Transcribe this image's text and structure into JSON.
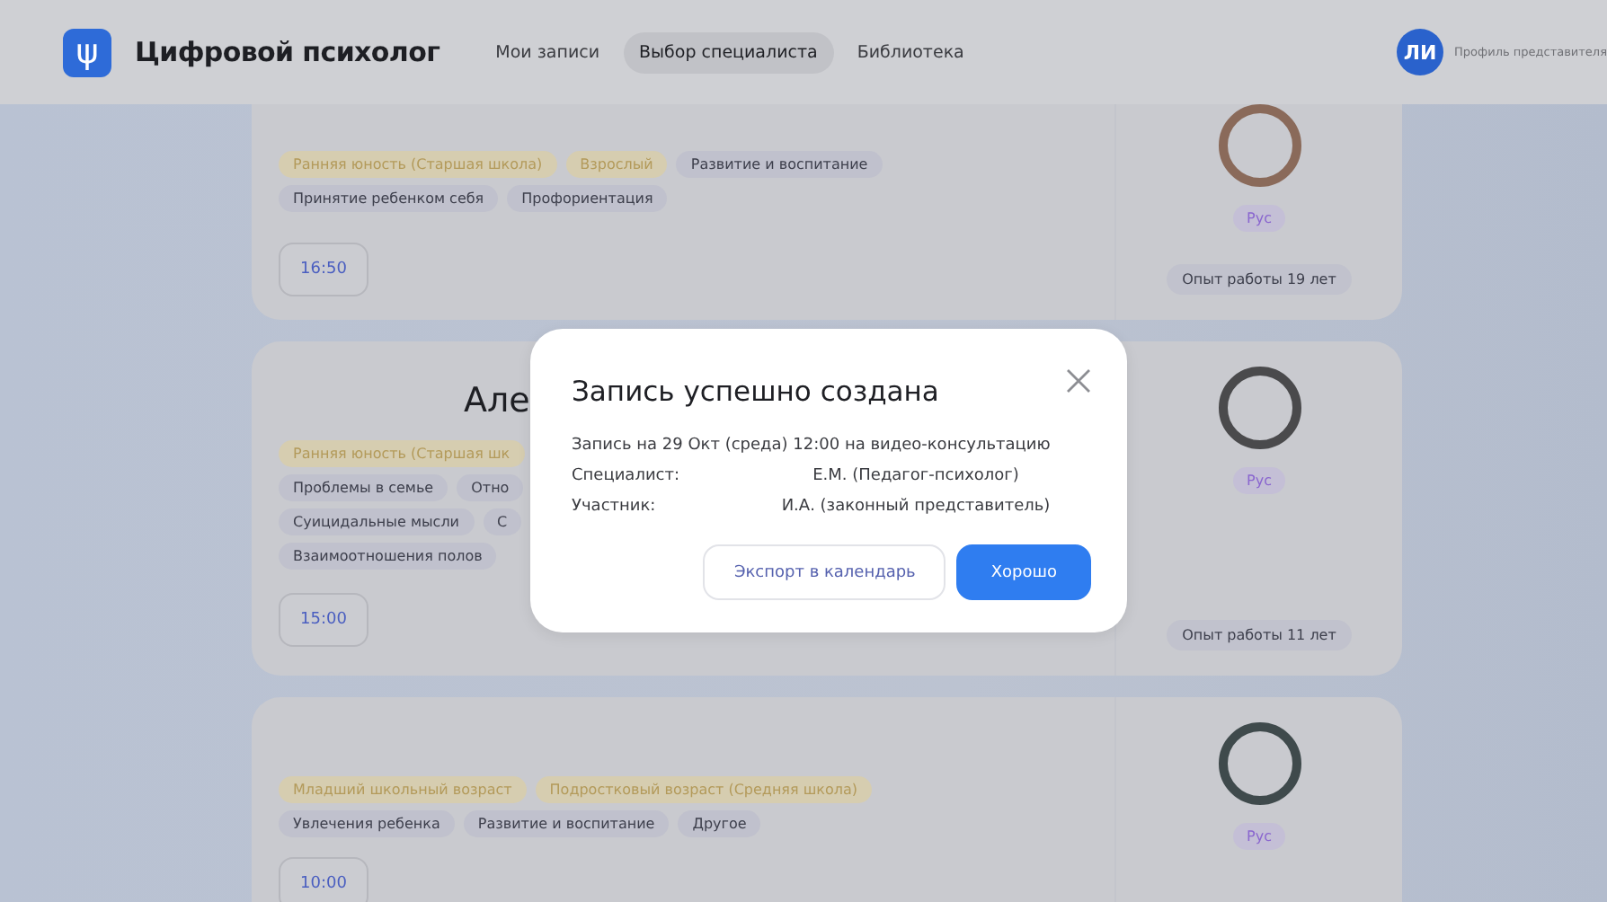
{
  "header": {
    "logo_glyph": "ψ",
    "app_title": "Цифровой психолог",
    "nav": [
      {
        "label": "Мои записи",
        "selected": false
      },
      {
        "label": "Выбор специалиста",
        "selected": true
      },
      {
        "label": "Библиотека",
        "selected": false
      }
    ],
    "profile": {
      "initials": "ЛИ",
      "label": "Профиль представителя"
    }
  },
  "specialists": [
    {
      "tags": [
        {
          "text": "Ранняя юность (Старшая школа)",
          "kind": "age"
        },
        {
          "text": "Взрослый",
          "kind": "age"
        },
        {
          "text": "Развитие и воспитание",
          "kind": "topic"
        },
        {
          "text": "Принятие ребенком себя",
          "kind": "topic"
        },
        {
          "text": "Профориентация",
          "kind": "topic"
        }
      ],
      "time": "16:50",
      "language": "Рус",
      "experience": "Опыт работы 19 лет"
    },
    {
      "name": "Але",
      "tags": [
        {
          "text": "Ранняя юность (Старшая шк",
          "kind": "age"
        },
        {
          "text": "Проблемы в семье",
          "kind": "topic"
        },
        {
          "text": "Отно",
          "kind": "topic"
        },
        {
          "text": "Суицидальные мысли",
          "kind": "topic"
        },
        {
          "text": "С",
          "kind": "topic"
        },
        {
          "text": "Взаимоотношения полов",
          "kind": "topic"
        }
      ],
      "time": "15:00",
      "language": "Рус",
      "experience": "Опыт работы 11 лет"
    },
    {
      "tags": [
        {
          "text": "Младший школьный возраст",
          "kind": "age"
        },
        {
          "text": "Подростковый возраст (Средняя школа)",
          "kind": "age"
        },
        {
          "text": "Увлечения ребенка",
          "kind": "topic"
        },
        {
          "text": "Развитие и воспитание",
          "kind": "topic"
        },
        {
          "text": "Другое",
          "kind": "topic"
        }
      ],
      "time": "10:00",
      "language": "Рус"
    }
  ],
  "modal": {
    "title": "Запись успешно создана",
    "summary": "Запись на 29 Окт (среда) 12:00 на видео-консультацию",
    "rows": [
      {
        "label": "Специалист:",
        "value": "Е.М. (Педагог-психолог)"
      },
      {
        "label": "Участник:",
        "value": "И.А. (законный представитель)"
      }
    ],
    "buttons": [
      {
        "label": "Экспорт в календарь",
        "kind": "secondary"
      },
      {
        "label": "Хорошо",
        "kind": "primary"
      }
    ]
  }
}
